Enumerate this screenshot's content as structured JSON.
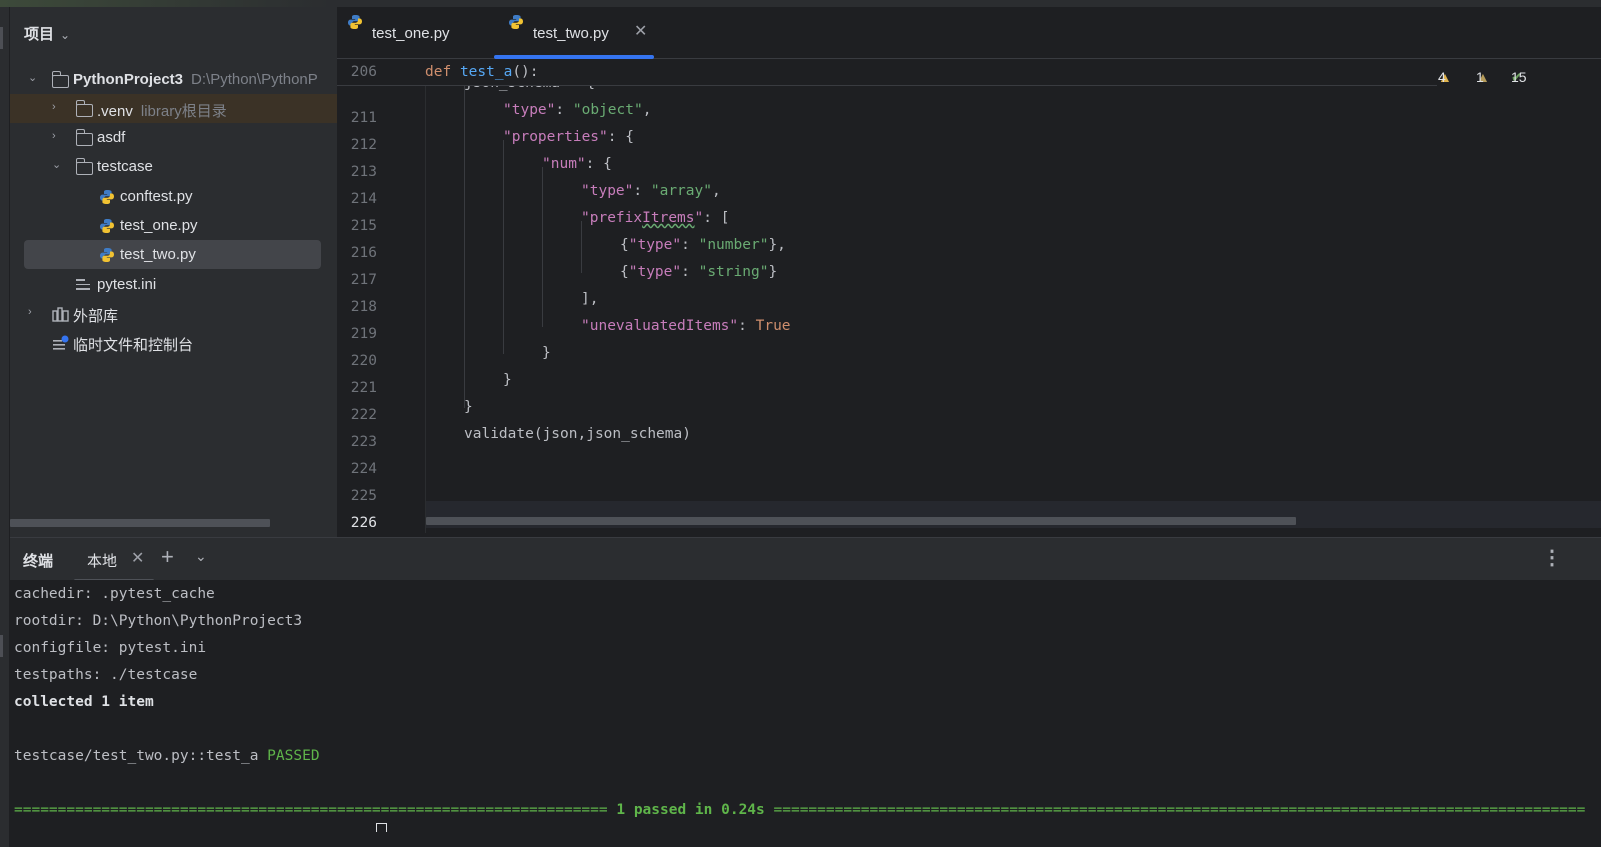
{
  "project_panel": {
    "title": "项目",
    "root": {
      "name": "PythonProject3",
      "path": "D:\\Python\\PythonP"
    },
    "items": [
      {
        "name": ".venv",
        "note": "library根目录"
      },
      {
        "name": "asdf"
      },
      {
        "name": "testcase"
      },
      {
        "name": "conftest.py"
      },
      {
        "name": "test_one.py"
      },
      {
        "name": "test_two.py"
      },
      {
        "name": "pytest.ini"
      },
      {
        "name": "外部库"
      },
      {
        "name": "临时文件和控制台"
      }
    ]
  },
  "editor": {
    "tabs": [
      {
        "label": "test_one.py"
      },
      {
        "label": "test_two.py"
      }
    ],
    "close_glyph": "✕",
    "sticky": {
      "line": "206",
      "kw": "def",
      "fn": "test_a",
      "rest": "():"
    },
    "inspections": {
      "warnings": "4",
      "weak_warnings": "1",
      "ok": "15"
    },
    "partial_line": "json_schema = {",
    "line_numbers": [
      "211",
      "212",
      "213",
      "214",
      "215",
      "216",
      "217",
      "218",
      "219",
      "220",
      "221",
      "222",
      "223",
      "224",
      "225",
      "226"
    ],
    "code": {
      "l211": {
        "k": "\"type\"",
        "colon": ": ",
        "v": "\"object\"",
        "end": ","
      },
      "l212": {
        "k": "\"properties\"",
        "end": ": {"
      },
      "l213": {
        "k": "\"num\"",
        "end": ": {"
      },
      "l214": {
        "k": "\"type\"",
        "colon": ": ",
        "v": "\"array\"",
        "end": ","
      },
      "l215": {
        "q1": "\"",
        "k1": "prefix",
        "k2": "Itrems",
        "q2": "\"",
        "end": ": ["
      },
      "l216": {
        "open": "{",
        "k": "\"type\"",
        "colon": ": ",
        "v": "\"number\"",
        "end": "},"
      },
      "l217": {
        "open": "{",
        "k": "\"type\"",
        "colon": ": ",
        "v": "\"string\"",
        "end": "}"
      },
      "l218": "],",
      "l219": {
        "k": "\"unevaluatedItems\"",
        "colon": ": ",
        "v": "True"
      },
      "l220": "}",
      "l221": "}",
      "l222": "}",
      "l223": "validate(json,json_schema)"
    }
  },
  "terminal": {
    "title": "终端",
    "tab": "本地",
    "close_glyph": "✕",
    "plus": "+",
    "chevron": "⌄",
    "more": "⋮",
    "lines": {
      "cachedir": "cachedir: .pytest_cache",
      "rootdir": "rootdir: D:\\Python\\PythonProject3",
      "configfile": "configfile: pytest.ini",
      "testpaths": "testpaths: ./testcase",
      "collected": "collected 1 item",
      "result_prefix": "testcase/test_two.py::test_a ",
      "result_status": "PASSED",
      "sep_left": "====================================================================",
      "summary": " 1 passed in 0.24s ",
      "sep_right": "============================================================================================="
    }
  },
  "colors": {
    "accent": "#3574f0",
    "passed": "#5fb54a",
    "string": "#6aab73",
    "keyword": "#cf8e6d",
    "function": "#56a8f5",
    "warning": "#e0b34c"
  }
}
